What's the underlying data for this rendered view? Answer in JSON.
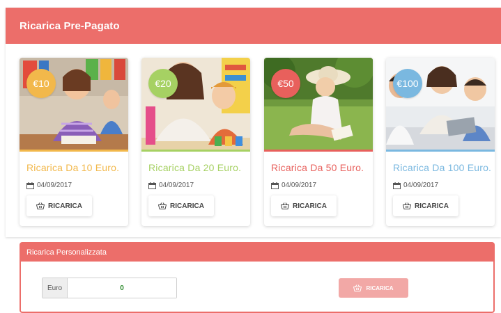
{
  "panel": {
    "title": "Ricarica Pre-Pagato"
  },
  "cards": [
    {
      "price": "€10",
      "title": "Ricarica Da 10 Euro.",
      "date": "04/09/2017",
      "button": "RICARICA",
      "color": "#f2b84b"
    },
    {
      "price": "€20",
      "title": "Ricarica Da 20 Euro.",
      "date": "04/09/2017",
      "button": "RICARICA",
      "color": "#a6d163"
    },
    {
      "price": "€50",
      "title": "Ricarica Da 50 Euro.",
      "date": "04/09/2017",
      "button": "RICARICA",
      "color": "#e8605c"
    },
    {
      "price": "€100",
      "title": "Ricarica Da 100 Euro.",
      "date": "04/09/2017",
      "button": "RICARICA",
      "color": "#7ab8e0"
    }
  ],
  "custom": {
    "title": "Ricarica Personalizzata",
    "euro_label": "Euro",
    "amount": "0",
    "button": "RICARICA"
  },
  "colors": {
    "accent": "#ec6e6a",
    "button_disabled": "#f2a8a6"
  }
}
